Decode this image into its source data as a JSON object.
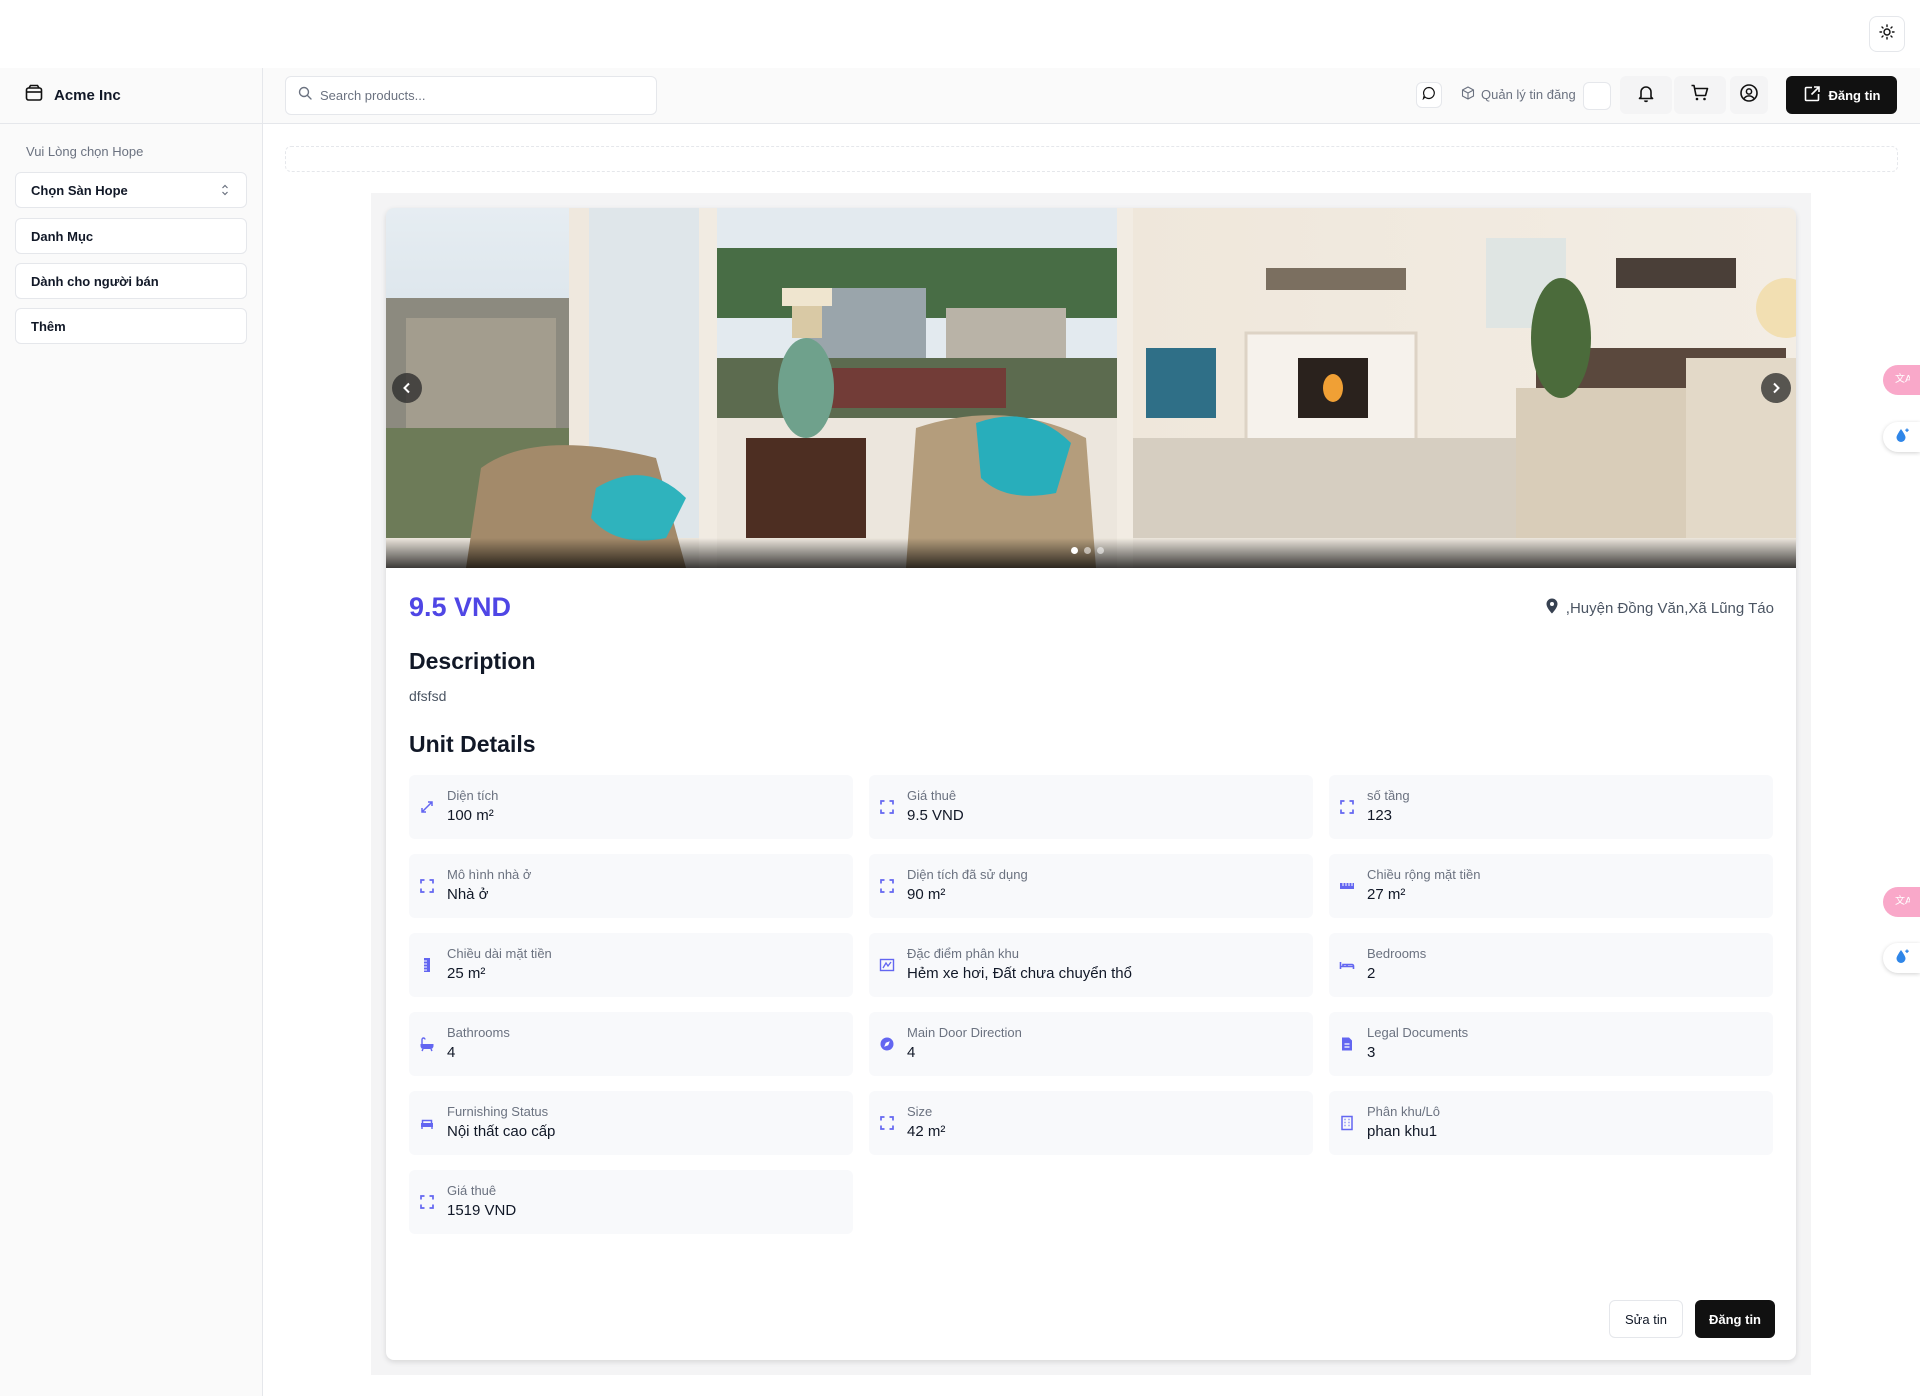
{
  "sidebar": {
    "brand": "Acme Inc",
    "label": "Vui Lòng chọn Hope",
    "select_value": "Chọn Sàn Hope",
    "items": [
      "Danh Mục",
      "Dành cho người bán",
      "Thêm"
    ]
  },
  "header": {
    "search_placeholder": "Search products...",
    "manage_label": "Quản lý tin đăng",
    "post_label": "Đăng tin"
  },
  "listing": {
    "price": "9.5 VND",
    "location": ",Huyện Đồng Văn,Xã Lũng Táo",
    "description_heading": "Description",
    "description": "dfsfsd",
    "unit_heading": "Unit Details",
    "carousel_slides": 3,
    "carousel_active": 0,
    "details": [
      {
        "label": "Diện tích",
        "value": "100 m²",
        "icon": "expand-arrows-icon"
      },
      {
        "label": "Giá thuê",
        "value": "9.5 VND",
        "icon": "frame-corners-icon"
      },
      {
        "label": "số tầng",
        "value": "123",
        "icon": "frame-corners-icon"
      },
      {
        "label": "Mô hình nhà ở",
        "value": "Nhà ở",
        "icon": "frame-corners-icon"
      },
      {
        "label": "Diện tích đã sử dụng",
        "value": "90 m²",
        "icon": "frame-corners-icon"
      },
      {
        "label": "Chiều rộng mặt tiền",
        "value": "27 m²",
        "icon": "ruler-horizontal-icon"
      },
      {
        "label": "Chiều dài mặt tiền",
        "value": "25 m²",
        "icon": "ruler-vertical-icon"
      },
      {
        "label": "Đặc điểm phân khu",
        "value": "Hẻm xe hơi, Đất chưa chuyển thổ",
        "icon": "map-icon"
      },
      {
        "label": "Bedrooms",
        "value": "2",
        "icon": "bed-icon"
      },
      {
        "label": "Bathrooms",
        "value": "4",
        "icon": "bath-icon"
      },
      {
        "label": "Main Door Direction",
        "value": "4",
        "icon": "compass-icon"
      },
      {
        "label": "Legal Documents",
        "value": "3",
        "icon": "document-icon"
      },
      {
        "label": "Furnishing Status",
        "value": "Nội thất cao cấp",
        "icon": "sofa-icon"
      },
      {
        "label": "Size",
        "value": "42 m²",
        "icon": "frame-corners-icon"
      },
      {
        "label": "Phân khu/Lô",
        "value": "phan khu1",
        "icon": "building-icon"
      },
      {
        "label": "Giá thuê",
        "value": "1519 VND",
        "icon": "frame-corners-icon"
      }
    ],
    "edit_label": "Sửa tin",
    "submit_label": "Đăng tin"
  },
  "colors": {
    "accent": "#4f46e5",
    "primary_button": "#111111",
    "detail_bg": "#f8f9fb"
  }
}
